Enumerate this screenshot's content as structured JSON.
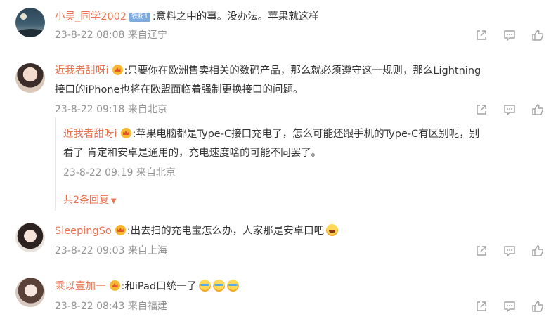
{
  "comments": [
    {
      "user": "小吴_同学2002",
      "fan_badge": "铁粉1",
      "text": ":意料之中的事。没办法。苹果就这样",
      "meta": "23-8-22 08:08 来自辽宁"
    },
    {
      "user": "近我者甜呀i",
      "text_line1": ":只要你在欧洲售卖相关的数码产品，那么就必须遵守这一规则，那么Lightning",
      "text_line2": "接口的iPhone也将在欧盟面临着强制更换接口的问题。",
      "meta": "23-8-22 09:18 来自北京",
      "reply": {
        "user": "近我者甜呀i",
        "text_line1": ":苹果电脑都是Type-C接口充电了，怎么可能还跟手机的Type-C有区别呢，别",
        "text_line2": "看了 肯定和安卓是通用的，充电速度啥的可能不同罢了。",
        "meta": "23-8-22 09:19 来自北京"
      },
      "more_replies": "共2条回复"
    },
    {
      "user": "SleepingSo",
      "text": ":出去扫的充电宝怎么办，人家那是安卓口吧",
      "meta": "23-8-22 09:03 来自上海"
    },
    {
      "user": "乘以壹加一",
      "text": ":和iPad口统一了",
      "meta": "23-8-22 08:43 来自福建"
    }
  ],
  "icons": {
    "share": "share-icon",
    "comment": "comment-icon",
    "like": "like-icon"
  },
  "colors": {
    "username": "#eb7350",
    "meta": "#939393",
    "text": "#333333",
    "icon": "#a3a3a3"
  }
}
